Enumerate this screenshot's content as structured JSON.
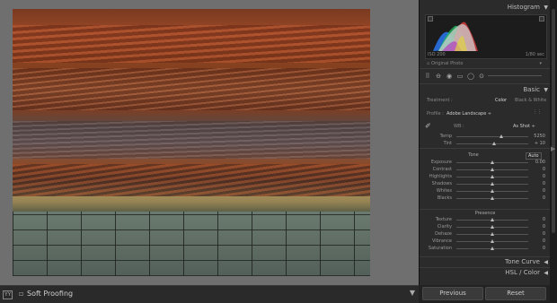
{
  "panel": {
    "histogram_title": "Histogram",
    "iso": "ISO 200",
    "focal": "",
    "shutter": "1/80 sec",
    "original_photo": "Original Photo",
    "basic_title": "Basic",
    "treatment_label": "Treatment :",
    "treatment_color": "Color",
    "treatment_bw": "Black & White",
    "profile_label": "Profile :",
    "profile_value": "Adobe Landscape ÷",
    "wb_label": "WB :",
    "wb_value": "As Shot ÷",
    "tone_title": "Tone",
    "tone_auto": "Auto",
    "presence_title": "Presence",
    "tone_curve_title": "Tone Curve",
    "hsl_title": "HSL / Color",
    "previous_button": "Previous",
    "reset_button": "Reset",
    "wb_rows": [
      {
        "label": "Temp",
        "value": "5250",
        "level": 0.62
      },
      {
        "label": "Tint",
        "value": "+ 10",
        "level": 0.53
      }
    ],
    "tone_rows": [
      {
        "label": "Exposure",
        "value": "0.00",
        "level": 0.5
      },
      {
        "label": "Contrast",
        "value": "0",
        "level": 0.5
      },
      {
        "label": "Highlights",
        "value": "0",
        "level": 0.5
      },
      {
        "label": "Shadows",
        "value": "0",
        "level": 0.5
      },
      {
        "label": "Whites",
        "value": "0",
        "level": 0.5
      },
      {
        "label": "Blacks",
        "value": "0",
        "level": 0.5
      }
    ],
    "presence_rows": [
      {
        "label": "Texture",
        "value": "0",
        "level": 0.5
      },
      {
        "label": "Clarity",
        "value": "0",
        "level": 0.5
      },
      {
        "label": "Dehaze",
        "value": "0",
        "level": 0.5
      },
      {
        "label": "Vibrance",
        "value": "0",
        "level": 0.5
      },
      {
        "label": "Saturation",
        "value": "0",
        "level": 0.5
      }
    ]
  },
  "toolbar": {
    "soft_proofing_label": "Soft Proofing",
    "view_icon": "YY"
  },
  "colors": {
    "accent": "#cfcfcf",
    "panel_bg": "#2b2b2b",
    "canvas_bg": "#6f6f6f"
  }
}
